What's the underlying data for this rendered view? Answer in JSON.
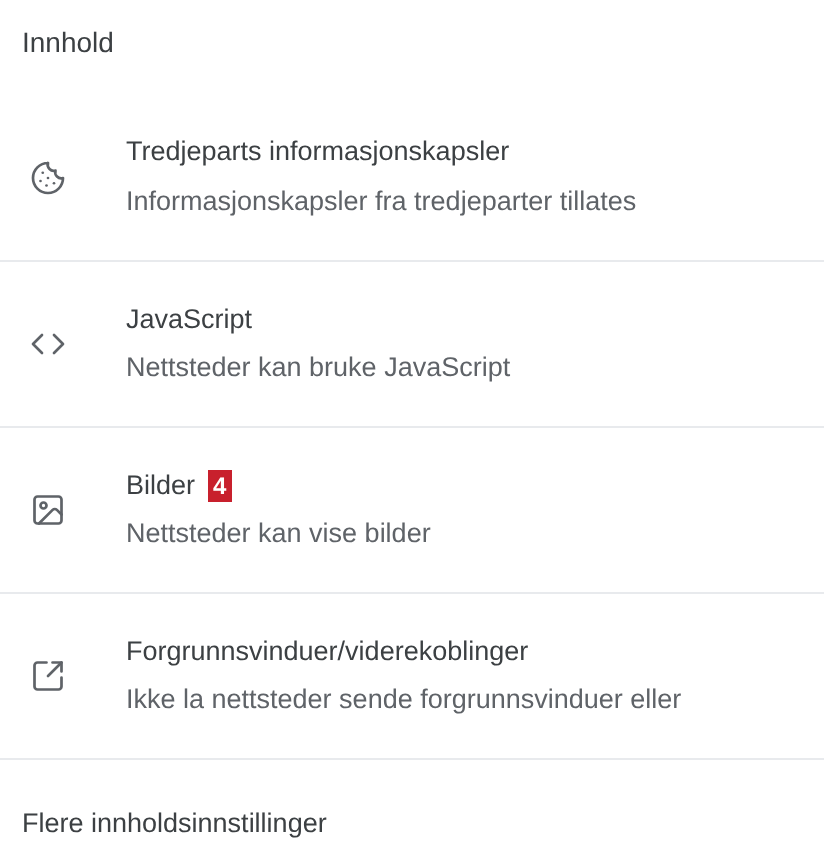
{
  "section_title": "Innhold",
  "items": [
    {
      "kind": "cookie",
      "title": "Tredjeparts informasjonskapsler",
      "subtitle": "Informasjonskapsler fra tredjeparter tillates"
    },
    {
      "kind": "code",
      "title": "JavaScript",
      "subtitle": "Nettsteder kan bruke JavaScript"
    },
    {
      "kind": "image",
      "title": "Bilder",
      "badge": "4",
      "subtitle": "Nettsteder kan vise bilder"
    },
    {
      "kind": "popup",
      "title": "Forgrunnsvinduer/viderekoblinger",
      "subtitle": "Ikke la nettsteder sende forgrunnsvinduer eller"
    }
  ],
  "more_link": "Flere innholdsinnstillinger"
}
